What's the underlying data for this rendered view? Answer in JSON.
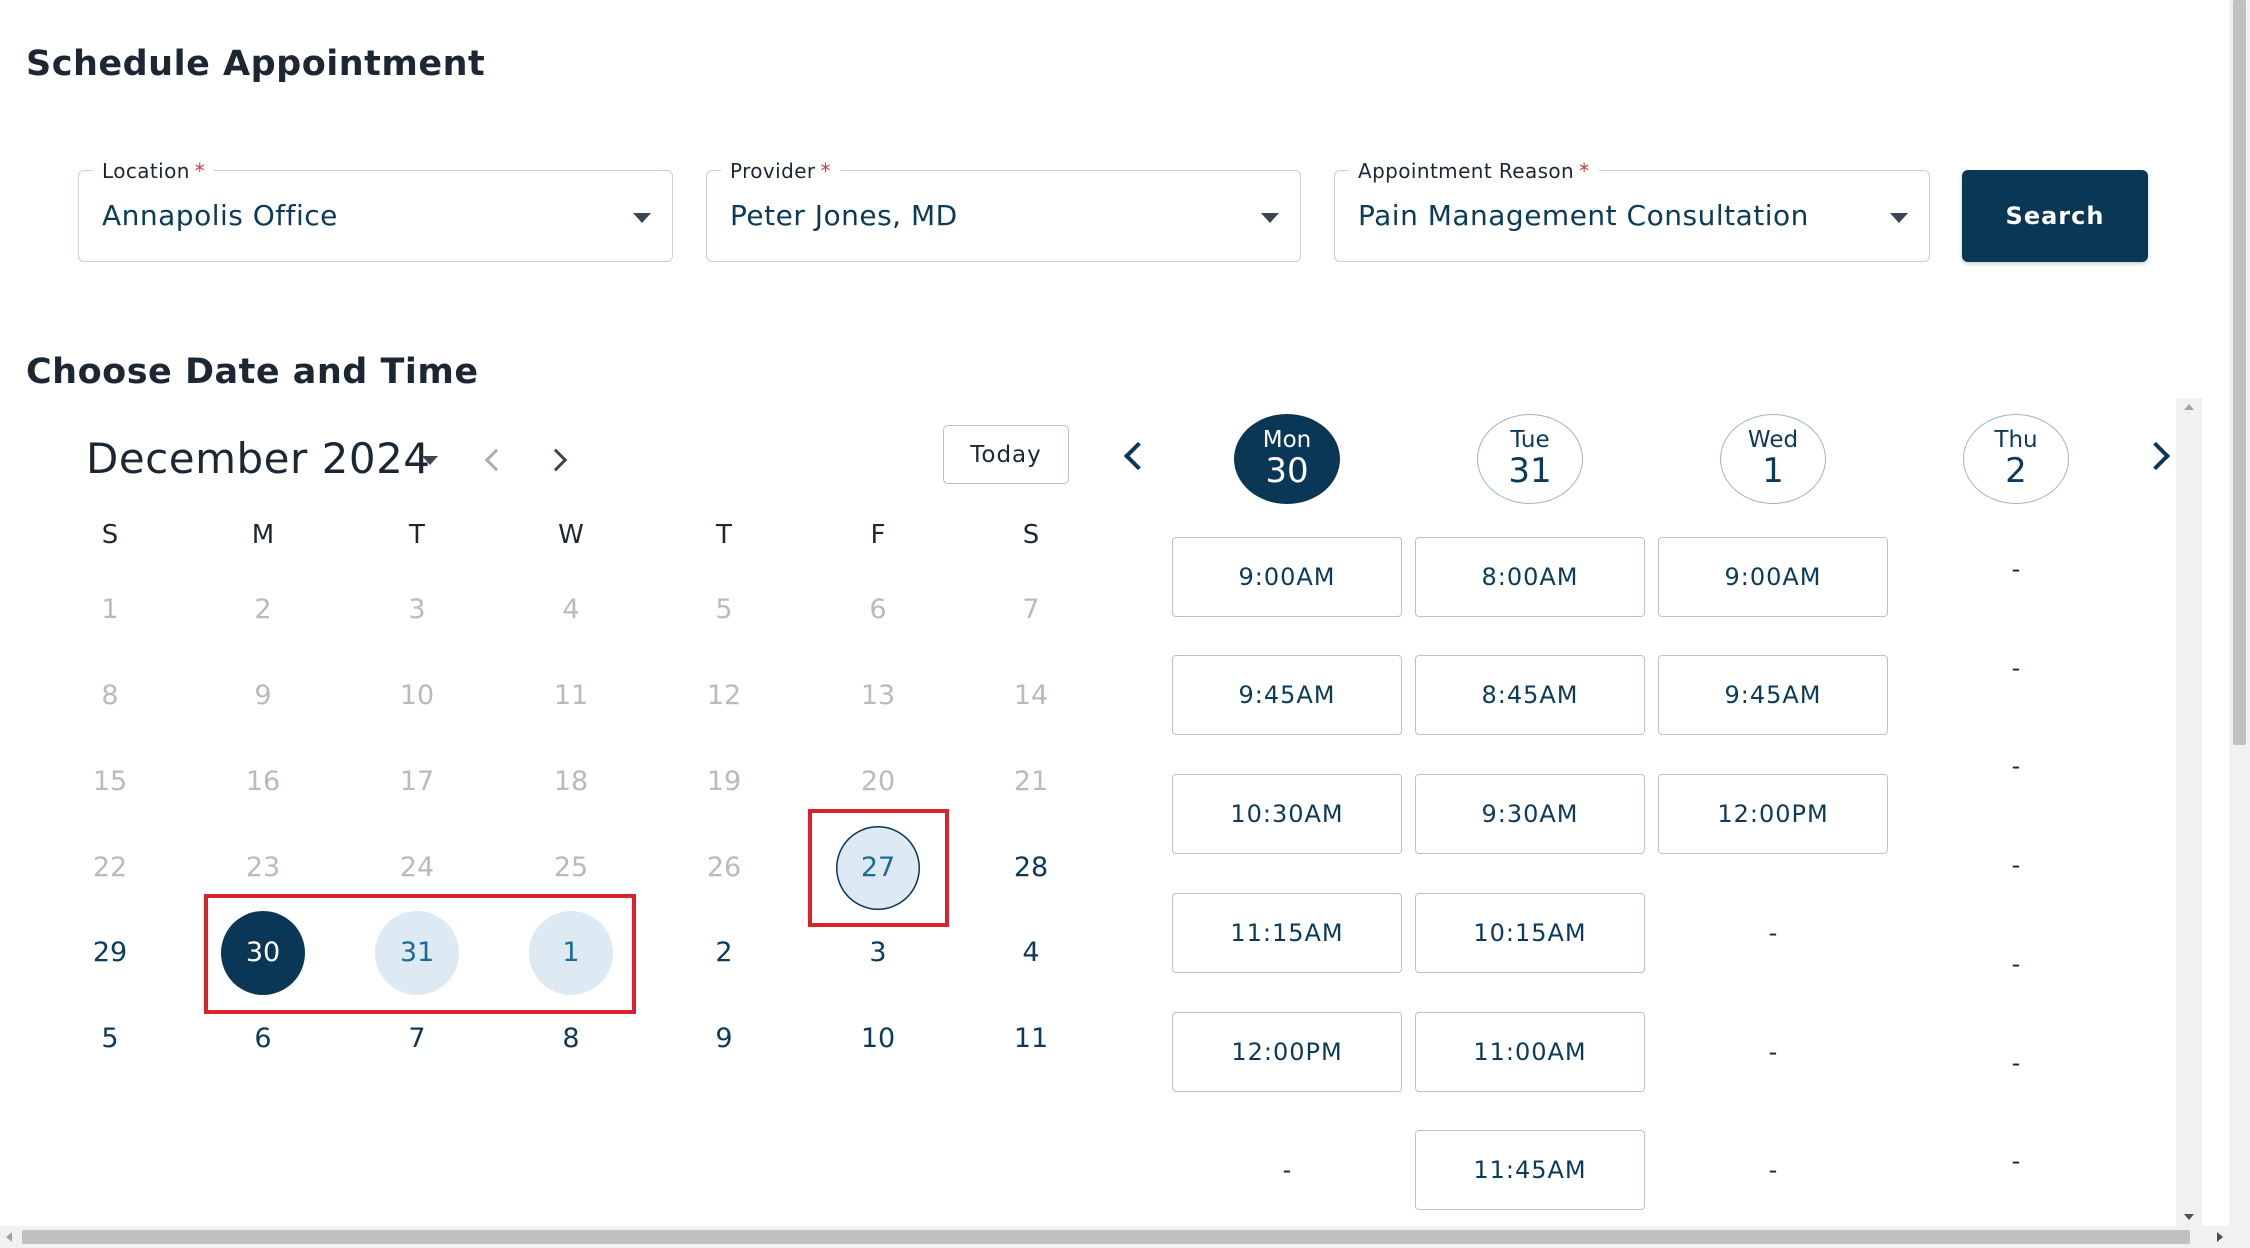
{
  "page_title": "Schedule Appointment",
  "fields": {
    "location": {
      "label": "Location",
      "required_mark": "*",
      "value": "Annapolis Office"
    },
    "provider": {
      "label": "Provider",
      "required_mark": "*",
      "value": "Peter Jones, MD"
    },
    "reason": {
      "label": "Appointment Reason",
      "required_mark": "*",
      "value": "Pain Management Consultation"
    }
  },
  "search_label": "Search",
  "section_title": "Choose Date and Time",
  "calendar": {
    "month_label": "December 2024",
    "today_label": "Today",
    "weekdays": [
      "S",
      "M",
      "T",
      "W",
      "T",
      "F",
      "S"
    ],
    "weeks": [
      [
        "1",
        "2",
        "3",
        "4",
        "5",
        "6",
        "7"
      ],
      [
        "8",
        "9",
        "10",
        "11",
        "12",
        "13",
        "14"
      ],
      [
        "15",
        "16",
        "17",
        "18",
        "19",
        "20",
        "21"
      ],
      [
        "22",
        "23",
        "24",
        "25",
        "26",
        "27",
        "28"
      ],
      [
        "29",
        "30",
        "31",
        "1",
        "2",
        "3",
        "4"
      ],
      [
        "5",
        "6",
        "7",
        "8",
        "9",
        "10",
        "11"
      ]
    ],
    "selected_day": "30",
    "highlighted_days": [
      "27",
      "31",
      "1"
    ]
  },
  "time_grid": {
    "days": [
      {
        "name": "Mon",
        "num": "30",
        "active": true,
        "slots": [
          "9:00AM",
          "9:45AM",
          "10:30AM",
          "11:15AM",
          "12:00PM",
          "-"
        ]
      },
      {
        "name": "Tue",
        "num": "31",
        "active": false,
        "slots": [
          "8:00AM",
          "8:45AM",
          "9:30AM",
          "10:15AM",
          "11:00AM",
          "11:45AM"
        ]
      },
      {
        "name": "Wed",
        "num": "1",
        "active": false,
        "slots": [
          "9:00AM",
          "9:45AM",
          "12:00PM",
          "-",
          "-",
          "-"
        ]
      },
      {
        "name": "Thu",
        "num": "2",
        "active": false,
        "slots": [
          "-",
          "-",
          "-",
          "-",
          "-",
          "-",
          "-"
        ]
      }
    ]
  },
  "colors": {
    "primary": "#0b3756",
    "highlight": "#dde9f3",
    "annotation_box": "#d8232a",
    "required": "#d23a3a"
  },
  "icons": [
    "caret-down-icon",
    "chevron-left-icon",
    "chevron-right-icon"
  ]
}
